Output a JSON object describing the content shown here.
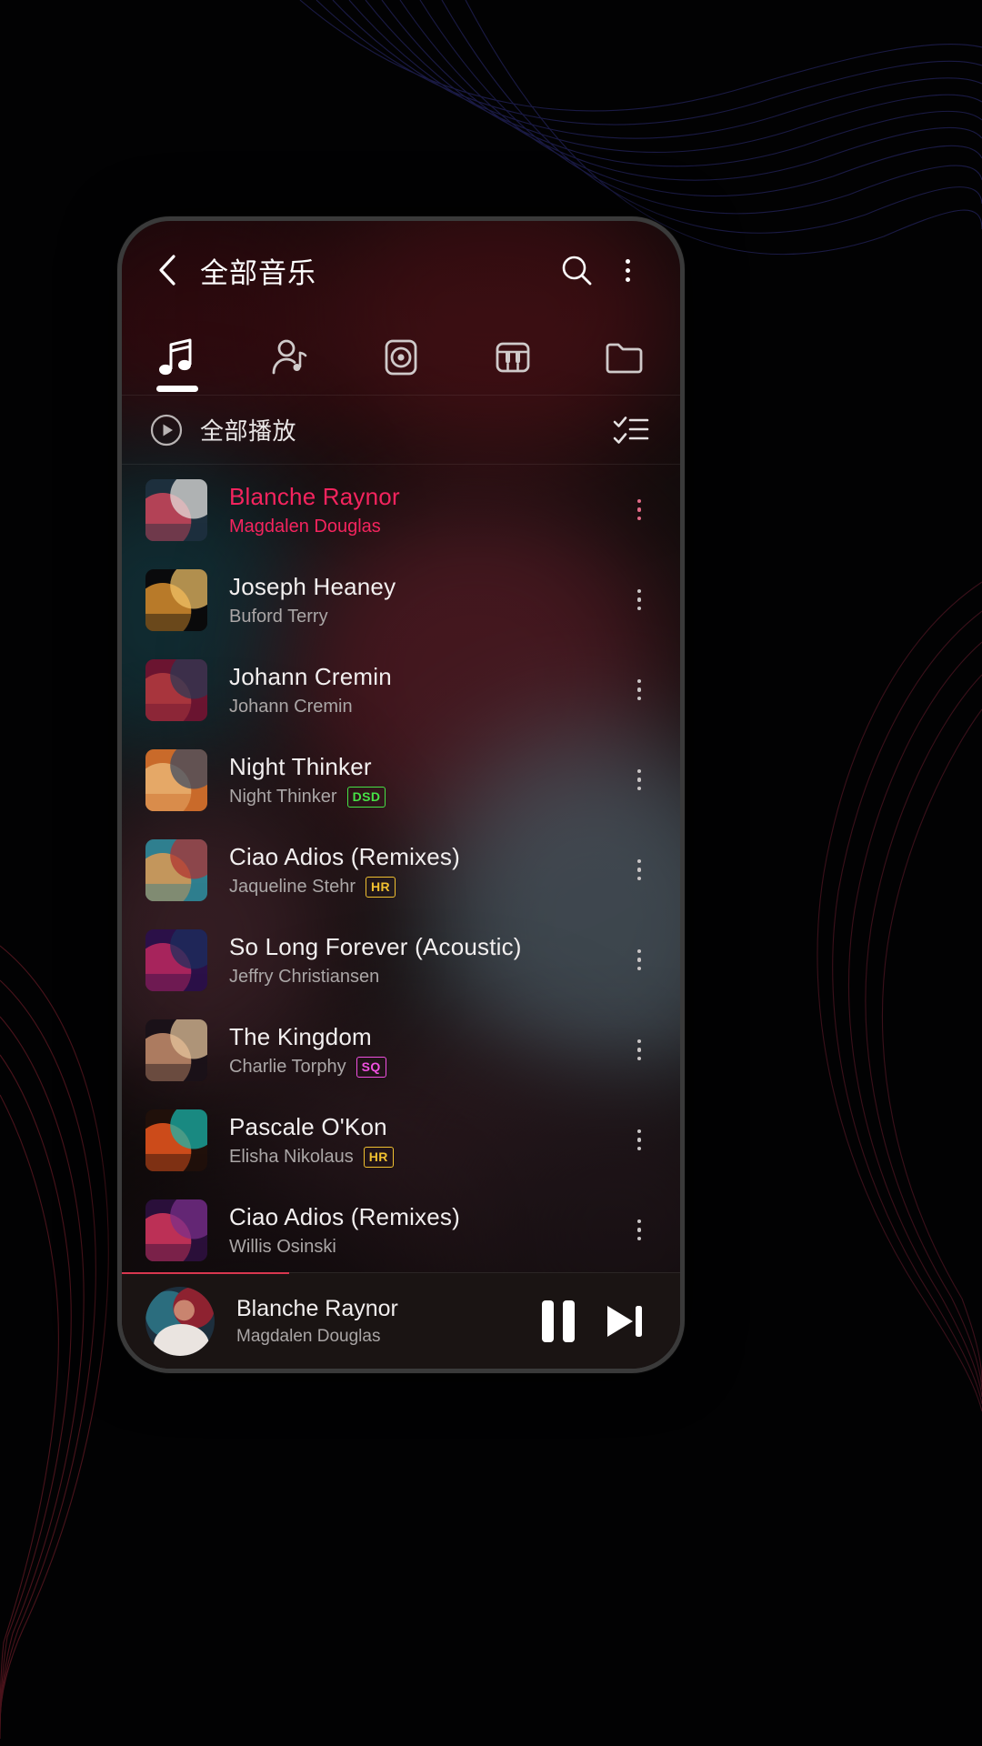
{
  "app": {
    "header": {
      "back_icon": "chevron-left-icon",
      "title": "全部音乐",
      "search_icon": "search-icon",
      "overflow_icon": "more-vertical-icon"
    },
    "tabs": [
      {
        "name": "songs",
        "icon": "music-note-icon",
        "active": true
      },
      {
        "name": "artists",
        "icon": "artist-icon",
        "active": false
      },
      {
        "name": "albums",
        "icon": "album-disc-icon",
        "active": false
      },
      {
        "name": "instruments",
        "icon": "piano-icon",
        "active": false
      },
      {
        "name": "folders",
        "icon": "folder-icon",
        "active": false
      }
    ],
    "playall": {
      "play_icon": "play-circle-icon",
      "label": "全部播放",
      "multiselect_icon": "checklist-icon"
    },
    "songs": [
      {
        "title": "Blanche Raynor",
        "artist": "Magdalen Douglas",
        "badge": "",
        "playing": true,
        "art": [
          "#1d2f3d",
          "#c8465a",
          "#e8e4e0"
        ]
      },
      {
        "title": "Joseph Heaney",
        "artist": "Buford Terry",
        "badge": "",
        "playing": false,
        "art": [
          "#0a0a0c",
          "#d08a2e",
          "#f2c468"
        ]
      },
      {
        "title": "Johann Cremin",
        "artist": "Johann Cremin",
        "badge": "",
        "playing": false,
        "art": [
          "#6b1430",
          "#b13a3f",
          "#2a3a55"
        ]
      },
      {
        "title": "Night Thinker",
        "artist": "Night Thinker",
        "badge": "DSD",
        "playing": false,
        "art": [
          "#c96a2a",
          "#e8b070",
          "#3a4a63"
        ]
      },
      {
        "title": "Ciao Adios (Remixes)",
        "artist": "Jaqueline Stehr",
        "badge": "HR",
        "playing": false,
        "art": [
          "#2f7f8f",
          "#d89a55",
          "#b03030"
        ]
      },
      {
        "title": "So Long Forever (Acoustic)",
        "artist": "Jeffry Christiansen",
        "badge": "",
        "playing": false,
        "art": [
          "#2b1048",
          "#b8275f",
          "#1b2f5e"
        ]
      },
      {
        "title": "The Kingdom",
        "artist": "Charlie Torphy",
        "badge": "SQ",
        "playing": false,
        "art": [
          "#1a1118",
          "#c08a6a",
          "#e8c89e"
        ]
      },
      {
        "title": "Pascale O'Kon",
        "artist": "Elisha Nikolaus",
        "badge": "HR",
        "playing": false,
        "art": [
          "#20100a",
          "#e4531c",
          "#16b8b0"
        ]
      },
      {
        "title": "Ciao Adios (Remixes)",
        "artist": "Willis Osinski",
        "badge": "",
        "playing": false,
        "art": [
          "#2a0f3a",
          "#d0365a",
          "#7a2f8a"
        ]
      }
    ],
    "badge_colors": {
      "DSD": "#46e246",
      "HR": "#f0c030",
      "SQ": "#f050e0"
    },
    "miniplayer": {
      "title": "Blanche Raynor",
      "artist": "Magdalen Douglas",
      "pause_icon": "pause-icon",
      "next_icon": "skip-next-icon",
      "progress_percent": 30
    }
  },
  "theme": {
    "accent": "#f4245e",
    "progress": "#d8374f",
    "background": "#000000"
  }
}
